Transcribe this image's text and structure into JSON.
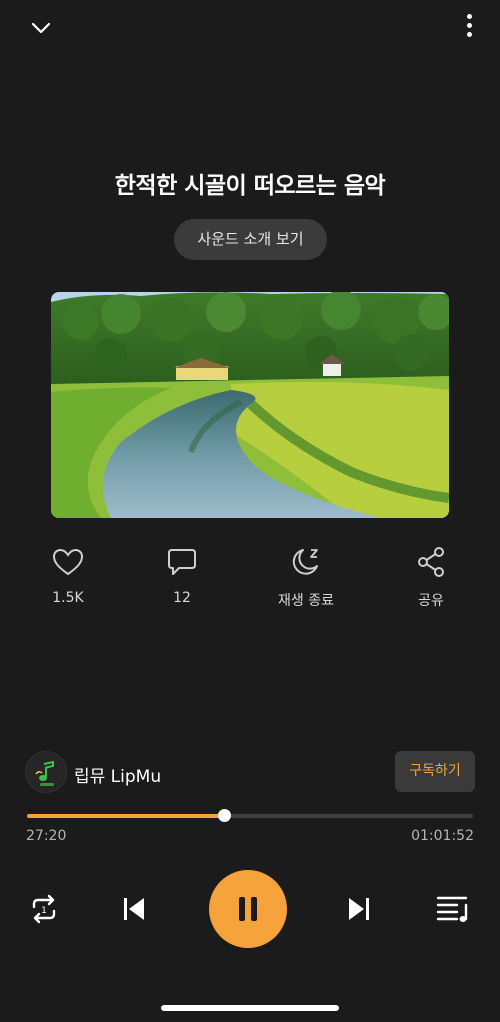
{
  "header": {
    "collapse_icon": "chevron-down-icon",
    "more_icon": "more-vertical-icon"
  },
  "track": {
    "title": "한적한 시골이 떠오르는 음악",
    "intro_button": "사운드 소개 보기",
    "artwork": "countryside-stream-landscape"
  },
  "actions": [
    {
      "icon": "heart-icon",
      "label": "1.5K"
    },
    {
      "icon": "comment-icon",
      "label": "12"
    },
    {
      "icon": "sleep-moon-icon",
      "label": "재생 종료"
    },
    {
      "icon": "share-icon",
      "label": "공유"
    }
  ],
  "channel": {
    "name": "립뮤 LipMu",
    "subscribe_label": "구독하기"
  },
  "playback": {
    "current_time": "27:20",
    "total_time": "01:01:52",
    "progress_fraction": 0.442
  },
  "controls": {
    "repeat_icon": "repeat-one-icon",
    "previous_icon": "skip-previous-icon",
    "play_pause_icon": "pause-icon",
    "next_icon": "skip-next-icon",
    "playlist_icon": "playlist-icon"
  },
  "colors": {
    "accent": "#f5a33a",
    "background": "#1b1b1b"
  }
}
